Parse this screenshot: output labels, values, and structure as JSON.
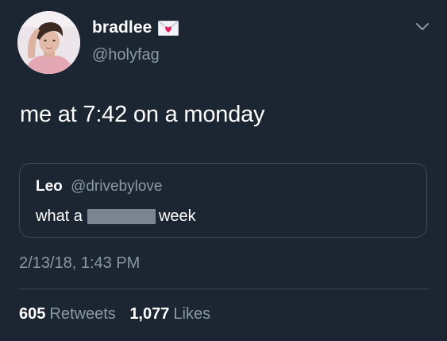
{
  "author": {
    "display_name": "bradlee",
    "handle": "@holyfag",
    "badge_icon": "heart-envelope-icon"
  },
  "tweet": {
    "text": "me at 7:42 on a monday"
  },
  "quoted_tweet": {
    "name": "Leo",
    "handle": "@drivebylove",
    "text_before": "what a",
    "text_after": "week"
  },
  "timestamp": "2/13/18, 1:43 PM",
  "stats": {
    "retweets_count": "605",
    "retweets_label": "Retweets",
    "likes_count": "1,077",
    "likes_label": "Likes"
  },
  "colors": {
    "background": "#1c2532",
    "secondary_text": "#8899a6",
    "border": "#3d4a5a",
    "censor": "#7b8592"
  }
}
